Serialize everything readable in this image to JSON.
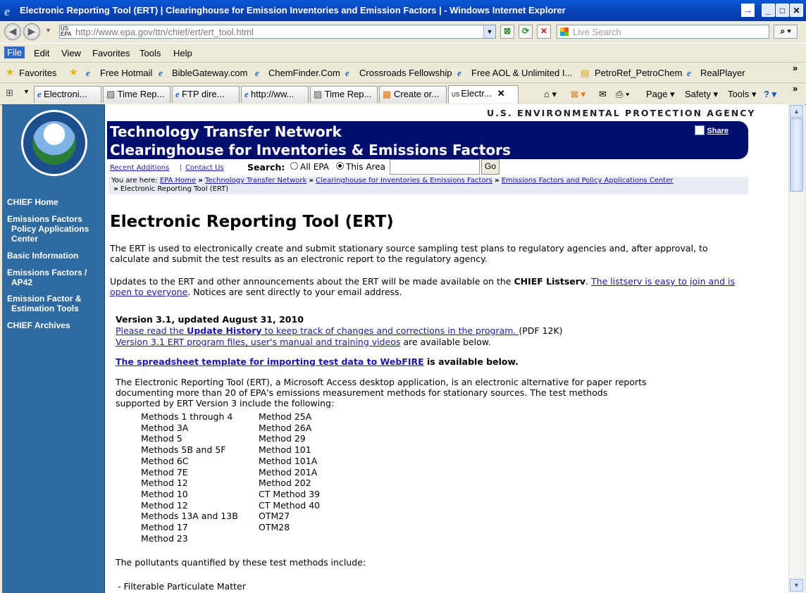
{
  "window": {
    "title": "Electronic Reporting Tool (ERT) | Clearinghouse for Emission Inventories and Emission Factors | - Windows Internet Explorer"
  },
  "address": {
    "url": "http://www.epa.gov/ttn/chief/ert/ert_tool.html",
    "search_placeholder": "Live Search"
  },
  "menu": [
    "File",
    "Edit",
    "View",
    "Favorites",
    "Tools",
    "Help"
  ],
  "favorites": {
    "label": "Favorites",
    "links": [
      "Free Hotmail",
      "BibleGateway.com",
      "ChemFinder.Com",
      "Crossroads Fellowship",
      "Free AOL & Unlimited I...",
      "PetroRef_PetroChem",
      "RealPlayer"
    ]
  },
  "tabs": [
    "Electroni...",
    "Time Rep...",
    "FTP dire...",
    "http://ww...",
    "Time Rep...",
    "Create or...",
    "Electr..."
  ],
  "toolbar": {
    "page": "Page",
    "safety": "Safety",
    "tools": "Tools"
  },
  "site": {
    "agency": "U.S. ENVIRONMENTAL PROTECTION AGENCY",
    "banner_line1": "Technology Transfer Network",
    "banner_line2": "Clearinghouse for Inventories & Emissions Factors",
    "share": "Share",
    "recent_additions": "Recent Additions",
    "sep": "|",
    "contact_us": "Contact Us",
    "search_label": "Search:",
    "radio_all": "All EPA",
    "radio_area": "This Area",
    "go": "Go",
    "you_are_here": "You are here:",
    "crumbs": [
      "EPA Home",
      "Technology Transfer Network",
      "Clearinghouse for Inventories & Emissions Factors",
      "Emissions Factors and Policy Applications Center"
    ],
    "crumb_current": "Electronic Reporting Tool (ERT)",
    "crumb_sep": "»"
  },
  "leftnav": [
    "CHIEF Home",
    "Emissions Factors",
    "Policy Applications",
    "Center",
    "Basic Information",
    "Emissions Factors /",
    "AP42",
    "Emission Factor &",
    "Estimation Tools",
    "CHIEF Archives"
  ],
  "seal_text": "UNITED STATES ENVIRONMENTAL PROTECTION AGENCY",
  "content": {
    "h1": "Electronic Reporting Tool (ERT)",
    "p1a": "The ERT is used to electronically create and submit stationary source sampling test plans to regulatory agencies and, after approval, to",
    "p1b": "calculate and submit the test results as an electronic report to the regulatory agency.",
    "p2a": "Updates to the ERT and other announcements about the ERT will be made available on the",
    "p2b": "CHIEF Listserv",
    "p2c": ".",
    "p2d": "The listserv is easy to join and is",
    "p2e": "open to everyone",
    "p2f": ". Notices are sent directly to your email address.",
    "version": "Version 3.1, updated August 31, 2010",
    "upd1": "Please read the",
    "upd2": "Update History",
    "upd3": "to keep track of changes and corrections in the program.",
    "upd4": "(PDF 12K)",
    "files_link": "Version 3.1 ERT program files, user's manual and training videos",
    "files_tail": " are available below.",
    "template_link": "The spreadsheet template for importing test data to WebFIRE",
    "template_tail": " is available below.",
    "p3a": "The Electronic Reporting Tool (ERT), a Microsoft Access desktop application, is an electronic alternative for paper reports",
    "p3b": "documenting more than 20 of EPA's emissions measurement methods for stationary sources. The test methods",
    "p3c": "supported by ERT Version 3 include the following:",
    "methods_col1": [
      "Methods 1 through 4",
      "Method 3A",
      "Method 5",
      "Methods 5B and 5F",
      "Method 6C",
      "Method 7E",
      "Method 12",
      "Method 10",
      "Method 12",
      "Methods 13A and 13B",
      "Method 17",
      "Method 23"
    ],
    "methods_col2": [
      "Method 25A",
      "Method 26A",
      "Method 29",
      "Method 101",
      "Method 101A",
      "Method 201A",
      "Method 202",
      "CT Method 39",
      "CT Method 40",
      "OTM27",
      "OTM28"
    ],
    "pollutants_intro": "The pollutants quantified by these test methods include:",
    "pollutant1": "- Filterable Particulate Matter"
  }
}
